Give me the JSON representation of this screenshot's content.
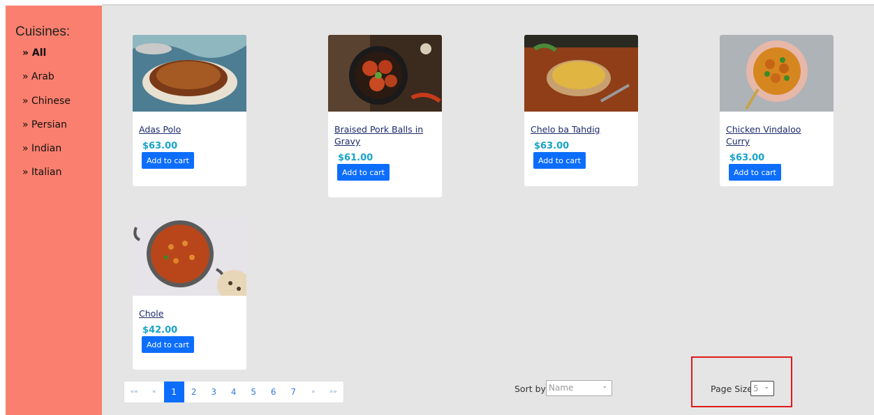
{
  "sidebar": {
    "title": "Cuisines:",
    "items": [
      {
        "label": "» All",
        "active": true
      },
      {
        "label": "» Arab"
      },
      {
        "label": "» Chinese"
      },
      {
        "label": "» Persian"
      },
      {
        "label": "» Indian"
      },
      {
        "label": "» Italian"
      }
    ]
  },
  "products": [
    {
      "name": "Adas Polo",
      "price": "$63.00",
      "button": "Add to cart"
    },
    {
      "name": "Braised Pork Balls in Gravy",
      "price": "$61.00",
      "button": "Add to cart"
    },
    {
      "name": "Chelo ba Tahdig",
      "price": "$63.00",
      "button": "Add to cart"
    },
    {
      "name": "Chicken Vindaloo Curry",
      "price": "$63.00",
      "button": "Add to cart"
    },
    {
      "name": "Chole",
      "price": "$42.00",
      "button": "Add to cart"
    }
  ],
  "pagination": {
    "first": "««",
    "prev": "«",
    "pages": [
      "1",
      "2",
      "3",
      "4",
      "5",
      "6",
      "7"
    ],
    "current": "1",
    "next": "»",
    "last": "»»"
  },
  "sort": {
    "label": "Sort by",
    "selected": "Name"
  },
  "page_size": {
    "label": "Page Size",
    "selected": "5"
  },
  "colors": {
    "sidebar_bg": "#fa7f6e",
    "main_bg": "#e5e5e5",
    "button": "#0d6efd",
    "price": "#17a3c9",
    "highlight": "#e01b1b"
  }
}
